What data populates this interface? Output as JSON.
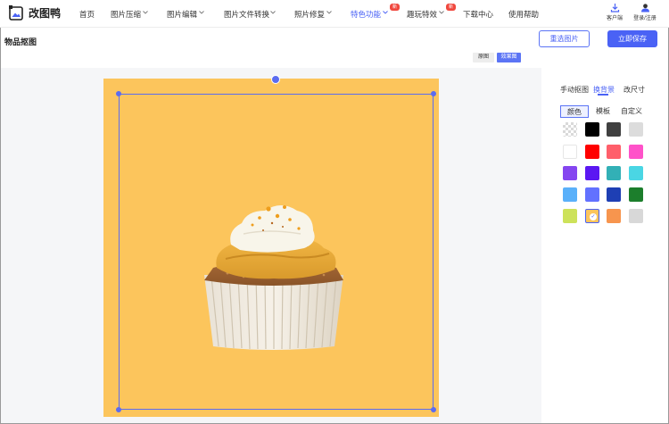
{
  "app": {
    "name": "改图鸭"
  },
  "nav": {
    "items": [
      {
        "label": "首页"
      },
      {
        "label": "图片压缩"
      },
      {
        "label": "图片编辑"
      },
      {
        "label": "图片文件转换"
      },
      {
        "label": "照片修复"
      },
      {
        "label": "特色功能"
      },
      {
        "label": "趣玩特效"
      },
      {
        "label": "下载中心"
      },
      {
        "label": "使用帮助"
      }
    ],
    "badge_new": "新",
    "active": "特色功能"
  },
  "header": {
    "client_label": "客户端",
    "login_label": "登录/注册"
  },
  "page": {
    "title": "物品抠图",
    "reselect_label": "重选图片",
    "save_label": "立即保存"
  },
  "view_toggle": {
    "original_label": "原图",
    "effect_label": "效果图",
    "active": "效果图"
  },
  "canvas": {
    "background_color": "#fcc55c"
  },
  "panel": {
    "tabs": [
      {
        "label": "手动抠图"
      },
      {
        "label": "换背景"
      },
      {
        "label": "改尺寸"
      }
    ],
    "active_tab": "换背景",
    "subtabs": [
      {
        "label": "颜色"
      },
      {
        "label": "模板"
      },
      {
        "label": "自定义"
      }
    ],
    "active_subtab": "颜色",
    "swatches": [
      "transparent",
      "#000000",
      "#404040",
      "#dcdcdc",
      "#ffffff",
      "#ff0000",
      "#ff5f6b",
      "#ff52c9",
      "#8546f0",
      "#5b18f2",
      "#32b0b6",
      "#4ad6e4",
      "#5ab0fa",
      "#6271ff",
      "#1e3fb4",
      "#1c7e2c",
      "#cde25a",
      "#fcc55c",
      "#f7954e",
      "#d8d8d8"
    ],
    "selected_swatch": "#fcc55c"
  },
  "colors": {
    "accent": "#4a62f5",
    "badge": "#f0483e"
  }
}
